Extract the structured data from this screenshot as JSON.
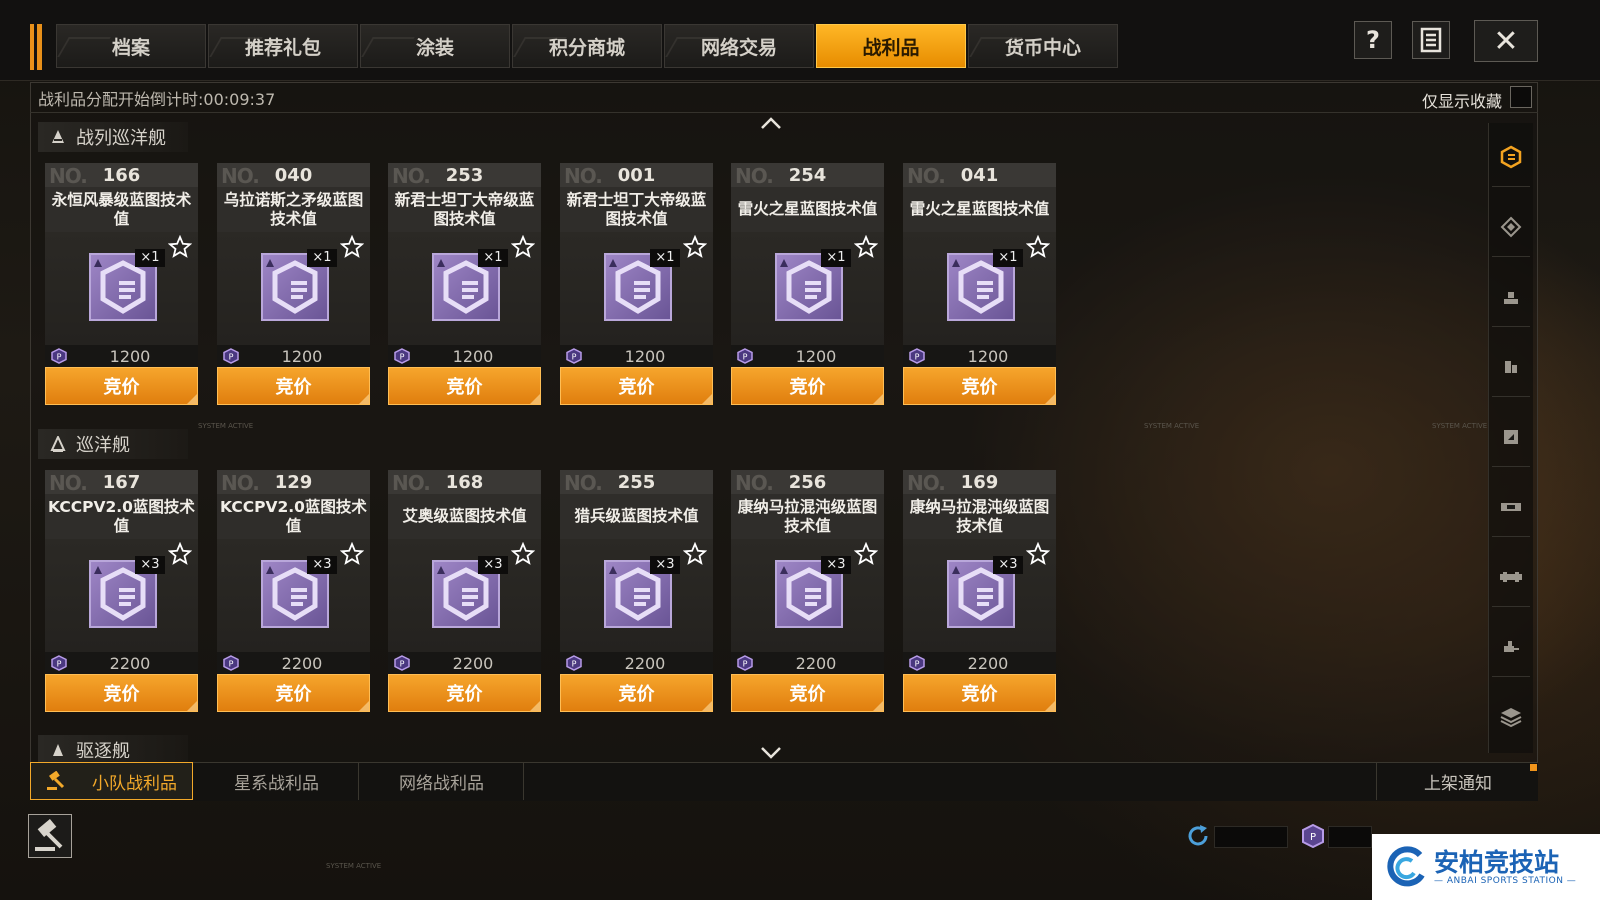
{
  "top_tabs": [
    {
      "label": "档案",
      "active": false
    },
    {
      "label": "推荐礼包",
      "active": false
    },
    {
      "label": "涂装",
      "active": false
    },
    {
      "label": "积分商城",
      "active": false
    },
    {
      "label": "网络交易",
      "active": false
    },
    {
      "label": "战利品",
      "active": true
    },
    {
      "label": "货币中心",
      "active": false
    }
  ],
  "top_icons": {
    "help": "question-icon",
    "log": "document-list-icon",
    "close": "close-icon"
  },
  "help_label": "?",
  "close_label": "✕",
  "countdown": "战利品分配开始倒计时:00:09:37",
  "fav_only_label": "仅显示收藏",
  "no_prefix": "NO.",
  "bid_label": "竞价",
  "sections": [
    {
      "title": "战列巡洋舰"
    },
    {
      "title": "巡洋舰"
    },
    {
      "title": "驱逐舰"
    }
  ],
  "battlecruiser_cards": [
    {
      "no": "166",
      "name": "永恒风暴级蓝图技术值",
      "qty": "×1",
      "price": "1200"
    },
    {
      "no": "040",
      "name": "乌拉诺斯之矛级蓝图技术值",
      "qty": "×1",
      "price": "1200"
    },
    {
      "no": "253",
      "name": "新君士坦丁大帝级蓝图技术值",
      "qty": "×1",
      "price": "1200"
    },
    {
      "no": "001",
      "name": "新君士坦丁大帝级蓝图技术值",
      "qty": "×1",
      "price": "1200"
    },
    {
      "no": "254",
      "name": "雷火之星蓝图技术值",
      "qty": "×1",
      "price": "1200"
    },
    {
      "no": "041",
      "name": "雷火之星蓝图技术值",
      "qty": "×1",
      "price": "1200"
    }
  ],
  "cruiser_cards": [
    {
      "no": "167",
      "name": "KCCPV2.0蓝图技术值",
      "qty": "×3",
      "price": "2200"
    },
    {
      "no": "129",
      "name": "KCCPV2.0蓝图技术值",
      "qty": "×3",
      "price": "2200"
    },
    {
      "no": "168",
      "name": "艾奥级蓝图技术值",
      "qty": "×3",
      "price": "2200"
    },
    {
      "no": "255",
      "name": "猎兵级蓝图技术值",
      "qty": "×3",
      "price": "2200"
    },
    {
      "no": "256",
      "name": "康纳马拉混沌级蓝图技术值",
      "qty": "×3",
      "price": "2200"
    },
    {
      "no": "169",
      "name": "康纳马拉混沌级蓝图技术值",
      "qty": "×3",
      "price": "2200"
    }
  ],
  "bottom_tabs": [
    {
      "label": "小队战利品",
      "active": true
    },
    {
      "label": "星系战利品",
      "active": false
    },
    {
      "label": "网络战利品",
      "active": false
    }
  ],
  "listing_notice": "上架通知",
  "rail_icons": [
    "all-category-icon",
    "capital-ship-icon",
    "carrier-icon",
    "battleship-icon",
    "battlecruiser-icon",
    "cruiser-icon",
    "destroyer-icon",
    "frigate-icon",
    "layers-icon"
  ],
  "faint_texts": [
    "SYSTEM ACTIVE",
    "SYSTEM ACTIVE",
    "SYSTEM ACTIVE",
    "SYSTEM ACTIVE"
  ],
  "watermark": {
    "title": "安柏竞技站",
    "subtitle": "— ANBAI SPORTS STATION —"
  },
  "colors": {
    "accent": "#f0941b",
    "active_tab": "#ffb726",
    "item_purple": "#8a74b8"
  }
}
